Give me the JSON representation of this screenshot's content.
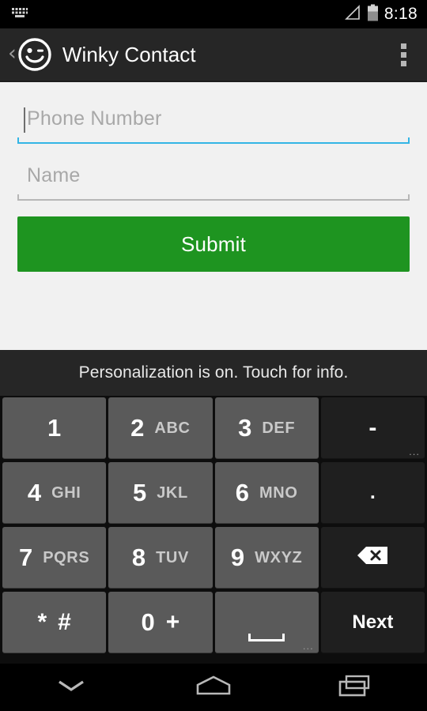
{
  "statusbar": {
    "ime_icon": "keyboard-icon",
    "signal_icon": "signal-triangle-icon",
    "battery_icon": "battery-icon",
    "time": "8:18"
  },
  "actionbar": {
    "back_icon": "back-chevron-icon",
    "logo_icon": "winky-face-logo-icon",
    "title": "Winky Contact",
    "overflow_icon": "overflow-menu-icon"
  },
  "form": {
    "phone": {
      "value": "",
      "placeholder": "Phone Number",
      "focused": true
    },
    "name": {
      "value": "",
      "placeholder": "Name",
      "focused": false
    },
    "submit_label": "Submit",
    "submit_color": "#1e9420",
    "focus_color": "#33b5e5",
    "idle_color": "#b7b7b7",
    "background": "#f1f1f1"
  },
  "keyboard": {
    "suggestion": "Personalization is on. Touch for info.",
    "rows": [
      [
        {
          "name": "key-1",
          "num": "1",
          "letters": "",
          "type": "normal"
        },
        {
          "name": "key-2",
          "num": "2",
          "letters": "ABC",
          "type": "normal"
        },
        {
          "name": "key-3",
          "num": "3",
          "letters": "DEF",
          "type": "normal"
        },
        {
          "name": "key-dash",
          "sym": "-",
          "type": "func",
          "hint": "..."
        }
      ],
      [
        {
          "name": "key-4",
          "num": "4",
          "letters": "GHI",
          "type": "normal"
        },
        {
          "name": "key-5",
          "num": "5",
          "letters": "JKL",
          "type": "normal"
        },
        {
          "name": "key-6",
          "num": "6",
          "letters": "MNO",
          "type": "normal"
        },
        {
          "name": "key-period",
          "sym": ".",
          "type": "func"
        }
      ],
      [
        {
          "name": "key-7",
          "num": "7",
          "letters": "PQRS",
          "type": "normal"
        },
        {
          "name": "key-8",
          "num": "8",
          "letters": "TUV",
          "type": "normal"
        },
        {
          "name": "key-9",
          "num": "9",
          "letters": "WXYZ",
          "type": "normal"
        },
        {
          "name": "key-backspace",
          "icon": "backspace-icon",
          "type": "func"
        }
      ],
      [
        {
          "name": "key-star-hash",
          "sym": "*",
          "sym2": "#",
          "type": "normal"
        },
        {
          "name": "key-0-plus",
          "num": "0",
          "sym2": "+",
          "type": "normal"
        },
        {
          "name": "key-space",
          "icon": "space-icon",
          "type": "normal",
          "hint": "..."
        },
        {
          "name": "key-next",
          "label": "Next",
          "type": "func"
        }
      ]
    ],
    "key_normal_color": "#5a5a5a",
    "key_func_color": "#1f1f1f",
    "background": "#0d0d0d"
  },
  "navbar": {
    "back_label": "hide-keyboard",
    "back_icon": "chevron-down-icon",
    "home_icon": "home-icon",
    "recents_icon": "recents-icon"
  }
}
